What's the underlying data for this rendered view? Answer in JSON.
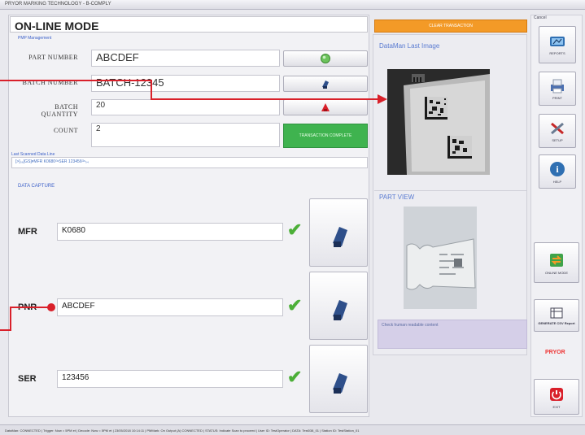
{
  "window": {
    "title": "PRYOR MARKING TECHNOLOGY - B-COMPLY"
  },
  "header": {
    "mode_title": "ON-LINE MODE",
    "clear_label": "CLEAR TRANSACTION"
  },
  "pmp_section": {
    "label": "PMP Management"
  },
  "fields": {
    "part_number": {
      "label": "PART NUMBER",
      "value": "ABCDEF"
    },
    "batch_number": {
      "label": "BATCH NUMBER",
      "value": "BATCH-12345"
    },
    "batch_quantity": {
      "label": "BATCH QUANTITY",
      "value": "20"
    },
    "count": {
      "label": "COUNT",
      "value": "2"
    }
  },
  "status_button": {
    "label": "TRANSACTION COMPLETE"
  },
  "log": {
    "label": "Last Scanned Data Line",
    "text": "[>]₀₆[GS]ᴘMFR K0680ᴳˢSER 123456ᴳˢ₀₄"
  },
  "data_capture": {
    "label": "DATA CAPTURE",
    "rows": [
      {
        "label": "MFR",
        "value": "K0680"
      },
      {
        "label": "PNR",
        "value": "ABCDEF"
      },
      {
        "label": "SER",
        "value": "123456"
      }
    ]
  },
  "right_panel": {
    "last_image_title": "DataMan Last Image",
    "part_view_title": "PART VIEW",
    "note_text": "Check human readable content"
  },
  "sidebar": {
    "title": "Cancel",
    "items": [
      {
        "label": "REPORTS",
        "icon": "reports-icon"
      },
      {
        "label": "PRINT",
        "icon": "print-icon"
      },
      {
        "label": "SETUP",
        "icon": "setup-icon"
      },
      {
        "label": "HELP",
        "icon": "help-icon"
      },
      {
        "label": "ONLINE MODE",
        "icon": "online-mode-icon"
      },
      {
        "label": "GENERATE CSV Report",
        "icon": "csv-icon"
      },
      {
        "label": "EXIT",
        "icon": "exit-icon"
      }
    ],
    "brand": "PRYOR"
  },
  "statusbar": {
    "text": "DataMan: CONNECTED | Trigger: Now = 5PM et | Decode: Now = 5PM et | 23/05/2018 10:14:11 | PMMark: On Output (A) CONNECTED | STATUS: Indicate Scan to proceed | User ID: TestOperator | DATA: Test038_01 | Station ID: TestStation_01"
  },
  "colors": {
    "accent": "#f39a27",
    "ok_green": "#3fb34f",
    "check_green": "#4caf38",
    "annotation_red": "#d9202a",
    "note_bg": "#d5cfe8"
  }
}
